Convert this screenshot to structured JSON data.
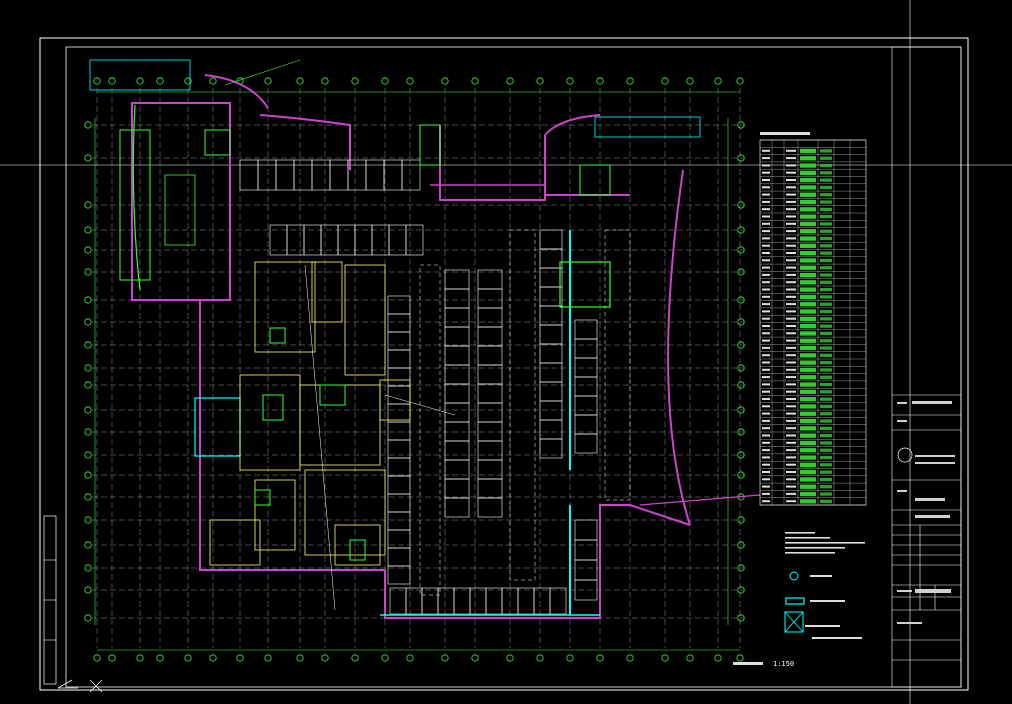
{
  "drawing": {
    "scale_label": "1:150",
    "colors": {
      "background": "#000000",
      "grid": "#ffffff",
      "axis": "#33ff33",
      "wall": "#cc44cc",
      "parking": "#ffffff",
      "core": "#00ffff",
      "equipment": "#ffff66",
      "schedule_fill": "#33cc33"
    }
  }
}
